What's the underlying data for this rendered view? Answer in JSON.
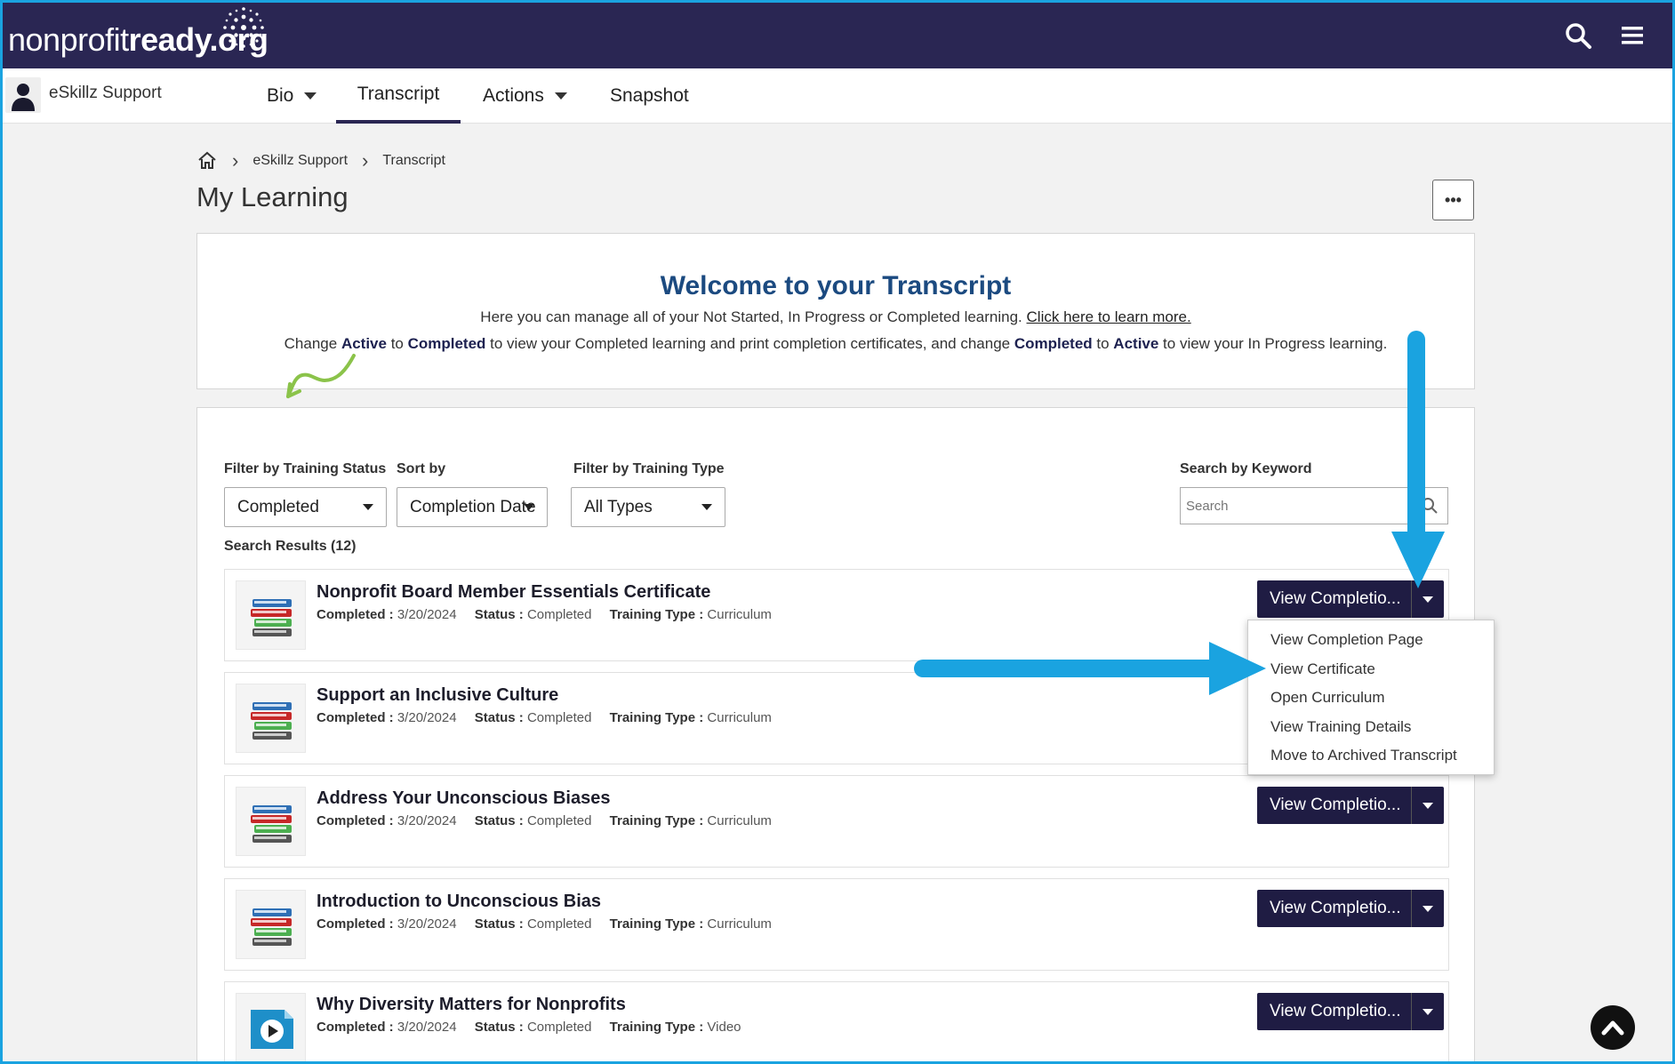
{
  "brand": {
    "logo_light": "nonprofit",
    "logo_bold": "ready.org"
  },
  "user": {
    "name": "eSkillz Support"
  },
  "nav": {
    "bio": "Bio",
    "transcript": "Transcript",
    "actions": "Actions",
    "snapshot": "Snapshot"
  },
  "breadcrumb": {
    "crumb1": "eSkillz Support",
    "crumb2": "Transcript"
  },
  "page": {
    "title": "My Learning",
    "more_label": "•••"
  },
  "welcome": {
    "title": "Welcome to your Transcript",
    "line1": "Here you can manage all of your Not Started, In Progress or Completed learning. ",
    "line1_link": "Click here to learn more.",
    "line2_a": "Change ",
    "line2_b": "Active",
    "line2_c": " to ",
    "line2_d": "Completed",
    "line2_e": " to view your Completed learning and print completion certificates, and change ",
    "line2_f": "Completed",
    "line2_g": " to ",
    "line2_h": "Active",
    "line2_i": " to view your In Progress learning."
  },
  "filters": {
    "status_label": "Filter by Training Status",
    "status_value": "Completed",
    "sort_label": "Sort by",
    "sort_value": "Completion Date",
    "type_label": "Filter by Training Type",
    "type_value": "All Types",
    "keyword_label": "Search by Keyword",
    "keyword_placeholder": "Search"
  },
  "results_count": "Search Results (12)",
  "labels": {
    "completed": "Completed :",
    "status": "Status :",
    "training_type": "Training Type :",
    "action_button": "View Completio..."
  },
  "items": [
    {
      "title": "Nonprofit Board Member Essentials Certificate",
      "date": "3/20/2024",
      "status": "Completed",
      "type": "Curriculum",
      "icon": "books-icon"
    },
    {
      "title": "Support an Inclusive Culture",
      "date": "3/20/2024",
      "status": "Completed",
      "type": "Curriculum",
      "icon": "books-icon"
    },
    {
      "title": "Address Your Unconscious Biases",
      "date": "3/20/2024",
      "status": "Completed",
      "type": "Curriculum",
      "icon": "books-icon"
    },
    {
      "title": "Introduction to Unconscious Bias",
      "date": "3/20/2024",
      "status": "Completed",
      "type": "Curriculum",
      "icon": "books-icon"
    },
    {
      "title": "Why Diversity Matters for Nonprofits",
      "date": "3/20/2024",
      "status": "Completed",
      "type": "Video",
      "icon": "video-play-icon"
    }
  ],
  "dropdown_menu": [
    "View Completion Page",
    "View Certificate",
    "Open Curriculum",
    "View Training Details",
    "Move to Archived Transcript"
  ],
  "colors": {
    "topbar": "#2a2653",
    "button": "#1f1c43",
    "welcome_title": "#1b4a80",
    "annotation_arrow": "#1aa3e0",
    "annotation_squiggle": "#8bc34a"
  }
}
